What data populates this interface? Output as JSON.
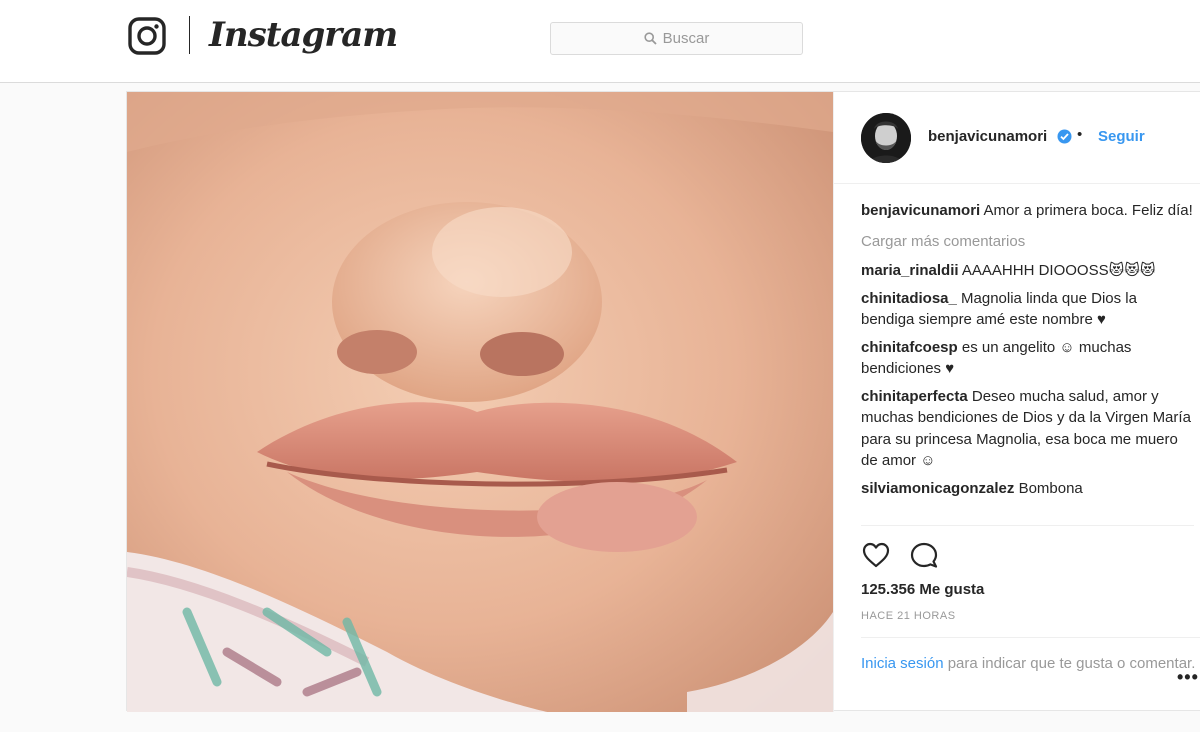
{
  "header": {
    "wordmark": "Instagram",
    "search_placeholder": "Buscar",
    "icons": [
      "instagram-camera-icon",
      "search-icon"
    ]
  },
  "post": {
    "username": "benjavicunamori",
    "verified": true,
    "separator": "•",
    "follow_label": "Seguir",
    "caption_user": "benjavicunamori",
    "caption_text": "Amor a primera boca. Feliz día!",
    "load_more": "Cargar más comentarios",
    "comments": [
      {
        "user": "maria_rinaldii",
        "text": "AAAAHHH DIOOOSS😻😻😻"
      },
      {
        "user": "chinitadiosa_",
        "text": "Magnolia linda que Dios la bendiga siempre amé este nombre ♥"
      },
      {
        "user": "chinitafcoesp",
        "text": "es un angelito ☺ muchas bendiciones ♥"
      },
      {
        "user": "chinitaperfecta",
        "text": "Deseo mucha salud, amor y muchas bendiciones de Dios y da la Virgen María para su princesa Magnolia, esa boca me muero de amor ☺"
      },
      {
        "user": "silviamonicagonzalez",
        "text": "Bombona"
      }
    ],
    "likes": "125.356 Me gusta",
    "time": "HACE 21 HORAS",
    "login_link": "Inicia sesión",
    "login_text": "para indicar que te gusta o comentar.",
    "more_label": "•••",
    "icons": [
      "heart-icon",
      "comment-icon",
      "verified-badge-icon"
    ]
  },
  "colors": {
    "link_blue": "#3897f0",
    "muted_gray": "#999999",
    "text": "#262626",
    "border": "#dbdbdb"
  }
}
